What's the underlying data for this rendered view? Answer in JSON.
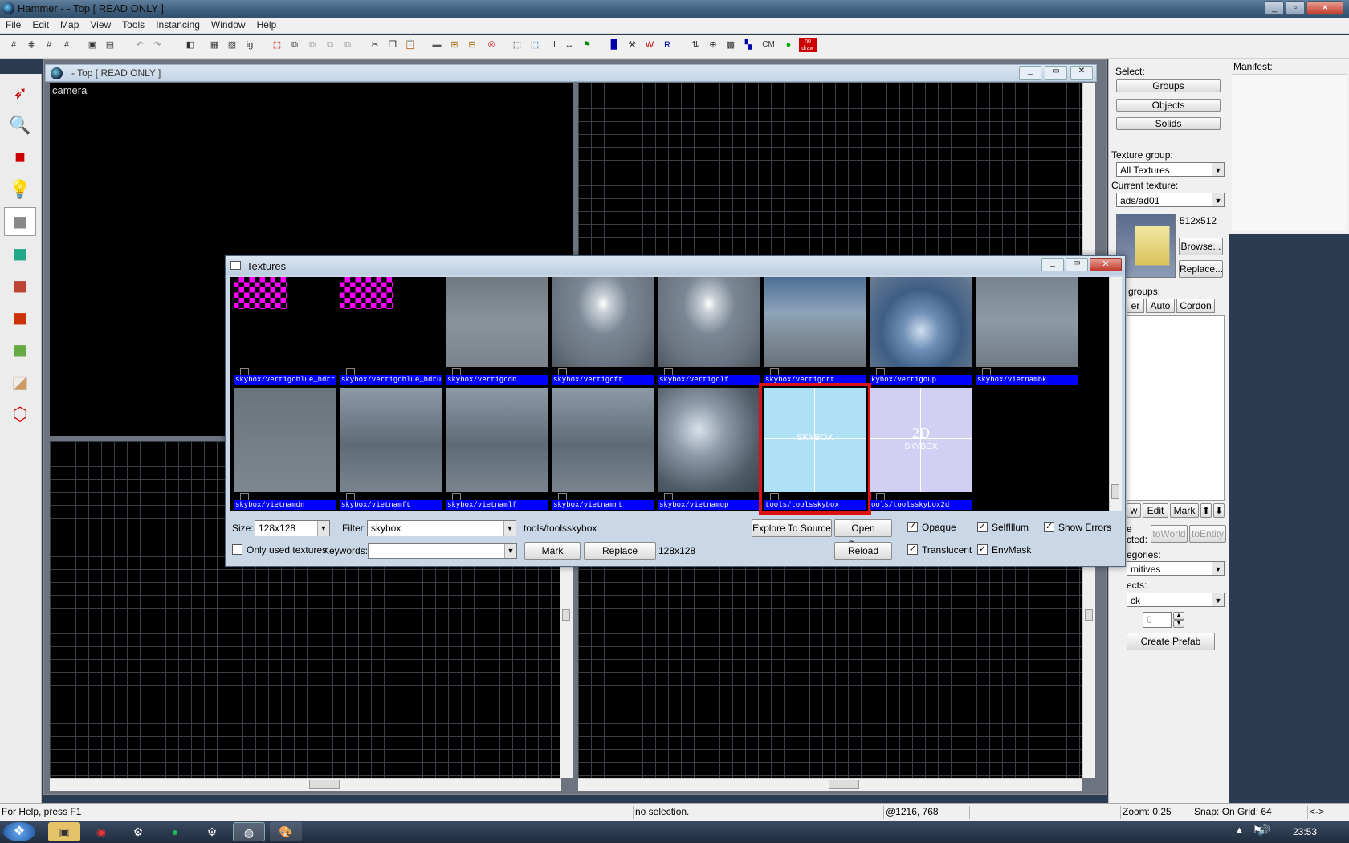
{
  "window": {
    "title": "Hammer -  - Top [ READ ONLY ]"
  },
  "menu": [
    "File",
    "Edit",
    "Map",
    "View",
    "Tools",
    "Instancing",
    "Window",
    "Help"
  ],
  "toolbar": {
    "text_buttons": [
      "tl",
      "CM",
      "no draw"
    ]
  },
  "child_window": {
    "title": "- Top [ READ ONLY ]",
    "camera_label": "camera"
  },
  "right_panel": {
    "select_label": "Select:",
    "groups": "Groups",
    "objects": "Objects",
    "solids": "Solids",
    "texture_group_label": "Texture group:",
    "texture_group_value": "All Textures",
    "current_texture_label": "Current texture:",
    "current_texture_value": "ads/ad01",
    "texture_size": "512x512",
    "browse": "Browse...",
    "replace": "Replace...",
    "visgroups_label": "groups:",
    "tab_user": "er",
    "tab_auto": "Auto",
    "tab_cordon": "Cordon",
    "btn_new": "w",
    "btn_edit": "Edit",
    "btn_mark": "Mark",
    "move_selected_1": "e",
    "move_selected_2": "cted:",
    "toworld": "toWorld",
    "toentity": "toEntity",
    "categories_label": "egories:",
    "categories_value": "mitives",
    "objects_label": "ects:",
    "objects_value": "ck",
    "faces_value": "0",
    "create_prefab": "Create Prefab"
  },
  "manifest": {
    "label": "Manifest:"
  },
  "textures_dialog": {
    "title": "Textures",
    "row1": [
      {
        "name": "skybox/vertigoblue_hdrrt",
        "style": "checker"
      },
      {
        "name": "skybox/vertigoblue_hdrup",
        "style": "checker"
      },
      {
        "name": "skybox/vertigodn",
        "style": "sky1"
      },
      {
        "name": "skybox/vertigoft",
        "style": "sky2"
      },
      {
        "name": "skybox/vertigolf",
        "style": "sky2"
      },
      {
        "name": "skybox/vertigort",
        "style": "sky3"
      },
      {
        "name": "kybox/vertigoup",
        "style": "sky4"
      },
      {
        "name": "skybox/vietnambk",
        "style": "sky5"
      }
    ],
    "row2": [
      {
        "name": "skybox/vietnamdn",
        "style": "sky6"
      },
      {
        "name": "skybox/vietnamft",
        "style": "sky7"
      },
      {
        "name": "skybox/vietnamlf",
        "style": "sky7"
      },
      {
        "name": "skybox/vietnamrt",
        "style": "sky7"
      },
      {
        "name": "skybox/vietnamup",
        "style": "sky8"
      },
      {
        "name": "tools/toolsskybox",
        "style": "skyblue",
        "overlay": "SKYBOX",
        "selected": true
      },
      {
        "name": "ools/toolsskybox2d",
        "style": "skylav",
        "overlay": "2D",
        "overlay2": "SKYBOX"
      }
    ],
    "size_label": "Size:",
    "size_value": "128x128",
    "filter_label": "Filter:",
    "filter_value": "skybox",
    "selected_name": "tools/toolsskybox",
    "explore": "Explore To Source",
    "open_source": "Open Source",
    "opaque": "Opaque",
    "selfillum": "SelfIllum",
    "show_errors": "Show Errors",
    "only_used": "Only used textures",
    "keywords_label": "Keywords:",
    "mark": "Mark",
    "replace": "Replace",
    "selected_size": "128x128",
    "reload": "Reload",
    "translucent": "Translucent",
    "envmask": "EnvMask"
  },
  "status": {
    "help": "For Help, press F1",
    "selection": "no selection.",
    "coords": "@1216, 768",
    "zoom": "Zoom: 0.25",
    "snap": "Snap: On Grid: 64",
    "arrows": "<->"
  },
  "taskbar": {
    "clock": "23:53"
  },
  "colors": {
    "name_bar": "#0000ff",
    "selection_outline": "#d11",
    "missing_texture": "#ff00ff"
  }
}
